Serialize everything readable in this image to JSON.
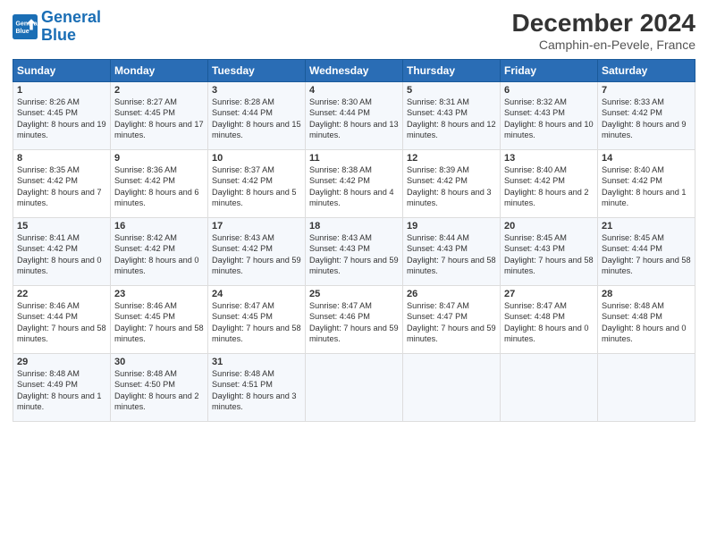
{
  "header": {
    "logo_line1": "General",
    "logo_line2": "Blue",
    "month": "December 2024",
    "location": "Camphin-en-Pevele, France"
  },
  "days_of_week": [
    "Sunday",
    "Monday",
    "Tuesday",
    "Wednesday",
    "Thursday",
    "Friday",
    "Saturday"
  ],
  "weeks": [
    [
      {
        "day": "1",
        "sunrise": "Sunrise: 8:26 AM",
        "sunset": "Sunset: 4:45 PM",
        "daylight": "Daylight: 8 hours and 19 minutes."
      },
      {
        "day": "2",
        "sunrise": "Sunrise: 8:27 AM",
        "sunset": "Sunset: 4:45 PM",
        "daylight": "Daylight: 8 hours and 17 minutes."
      },
      {
        "day": "3",
        "sunrise": "Sunrise: 8:28 AM",
        "sunset": "Sunset: 4:44 PM",
        "daylight": "Daylight: 8 hours and 15 minutes."
      },
      {
        "day": "4",
        "sunrise": "Sunrise: 8:30 AM",
        "sunset": "Sunset: 4:44 PM",
        "daylight": "Daylight: 8 hours and 13 minutes."
      },
      {
        "day": "5",
        "sunrise": "Sunrise: 8:31 AM",
        "sunset": "Sunset: 4:43 PM",
        "daylight": "Daylight: 8 hours and 12 minutes."
      },
      {
        "day": "6",
        "sunrise": "Sunrise: 8:32 AM",
        "sunset": "Sunset: 4:43 PM",
        "daylight": "Daylight: 8 hours and 10 minutes."
      },
      {
        "day": "7",
        "sunrise": "Sunrise: 8:33 AM",
        "sunset": "Sunset: 4:42 PM",
        "daylight": "Daylight: 8 hours and 9 minutes."
      }
    ],
    [
      {
        "day": "8",
        "sunrise": "Sunrise: 8:35 AM",
        "sunset": "Sunset: 4:42 PM",
        "daylight": "Daylight: 8 hours and 7 minutes."
      },
      {
        "day": "9",
        "sunrise": "Sunrise: 8:36 AM",
        "sunset": "Sunset: 4:42 PM",
        "daylight": "Daylight: 8 hours and 6 minutes."
      },
      {
        "day": "10",
        "sunrise": "Sunrise: 8:37 AM",
        "sunset": "Sunset: 4:42 PM",
        "daylight": "Daylight: 8 hours and 5 minutes."
      },
      {
        "day": "11",
        "sunrise": "Sunrise: 8:38 AM",
        "sunset": "Sunset: 4:42 PM",
        "daylight": "Daylight: 8 hours and 4 minutes."
      },
      {
        "day": "12",
        "sunrise": "Sunrise: 8:39 AM",
        "sunset": "Sunset: 4:42 PM",
        "daylight": "Daylight: 8 hours and 3 minutes."
      },
      {
        "day": "13",
        "sunrise": "Sunrise: 8:40 AM",
        "sunset": "Sunset: 4:42 PM",
        "daylight": "Daylight: 8 hours and 2 minutes."
      },
      {
        "day": "14",
        "sunrise": "Sunrise: 8:40 AM",
        "sunset": "Sunset: 4:42 PM",
        "daylight": "Daylight: 8 hours and 1 minute."
      }
    ],
    [
      {
        "day": "15",
        "sunrise": "Sunrise: 8:41 AM",
        "sunset": "Sunset: 4:42 PM",
        "daylight": "Daylight: 8 hours and 0 minutes."
      },
      {
        "day": "16",
        "sunrise": "Sunrise: 8:42 AM",
        "sunset": "Sunset: 4:42 PM",
        "daylight": "Daylight: 8 hours and 0 minutes."
      },
      {
        "day": "17",
        "sunrise": "Sunrise: 8:43 AM",
        "sunset": "Sunset: 4:42 PM",
        "daylight": "Daylight: 7 hours and 59 minutes."
      },
      {
        "day": "18",
        "sunrise": "Sunrise: 8:43 AM",
        "sunset": "Sunset: 4:43 PM",
        "daylight": "Daylight: 7 hours and 59 minutes."
      },
      {
        "day": "19",
        "sunrise": "Sunrise: 8:44 AM",
        "sunset": "Sunset: 4:43 PM",
        "daylight": "Daylight: 7 hours and 58 minutes."
      },
      {
        "day": "20",
        "sunrise": "Sunrise: 8:45 AM",
        "sunset": "Sunset: 4:43 PM",
        "daylight": "Daylight: 7 hours and 58 minutes."
      },
      {
        "day": "21",
        "sunrise": "Sunrise: 8:45 AM",
        "sunset": "Sunset: 4:44 PM",
        "daylight": "Daylight: 7 hours and 58 minutes."
      }
    ],
    [
      {
        "day": "22",
        "sunrise": "Sunrise: 8:46 AM",
        "sunset": "Sunset: 4:44 PM",
        "daylight": "Daylight: 7 hours and 58 minutes."
      },
      {
        "day": "23",
        "sunrise": "Sunrise: 8:46 AM",
        "sunset": "Sunset: 4:45 PM",
        "daylight": "Daylight: 7 hours and 58 minutes."
      },
      {
        "day": "24",
        "sunrise": "Sunrise: 8:47 AM",
        "sunset": "Sunset: 4:45 PM",
        "daylight": "Daylight: 7 hours and 58 minutes."
      },
      {
        "day": "25",
        "sunrise": "Sunrise: 8:47 AM",
        "sunset": "Sunset: 4:46 PM",
        "daylight": "Daylight: 7 hours and 59 minutes."
      },
      {
        "day": "26",
        "sunrise": "Sunrise: 8:47 AM",
        "sunset": "Sunset: 4:47 PM",
        "daylight": "Daylight: 7 hours and 59 minutes."
      },
      {
        "day": "27",
        "sunrise": "Sunrise: 8:47 AM",
        "sunset": "Sunset: 4:48 PM",
        "daylight": "Daylight: 8 hours and 0 minutes."
      },
      {
        "day": "28",
        "sunrise": "Sunrise: 8:48 AM",
        "sunset": "Sunset: 4:48 PM",
        "daylight": "Daylight: 8 hours and 0 minutes."
      }
    ],
    [
      {
        "day": "29",
        "sunrise": "Sunrise: 8:48 AM",
        "sunset": "Sunset: 4:49 PM",
        "daylight": "Daylight: 8 hours and 1 minute."
      },
      {
        "day": "30",
        "sunrise": "Sunrise: 8:48 AM",
        "sunset": "Sunset: 4:50 PM",
        "daylight": "Daylight: 8 hours and 2 minutes."
      },
      {
        "day": "31",
        "sunrise": "Sunrise: 8:48 AM",
        "sunset": "Sunset: 4:51 PM",
        "daylight": "Daylight: 8 hours and 3 minutes."
      },
      {
        "day": "",
        "sunrise": "",
        "sunset": "",
        "daylight": ""
      },
      {
        "day": "",
        "sunrise": "",
        "sunset": "",
        "daylight": ""
      },
      {
        "day": "",
        "sunrise": "",
        "sunset": "",
        "daylight": ""
      },
      {
        "day": "",
        "sunrise": "",
        "sunset": "",
        "daylight": ""
      }
    ]
  ]
}
